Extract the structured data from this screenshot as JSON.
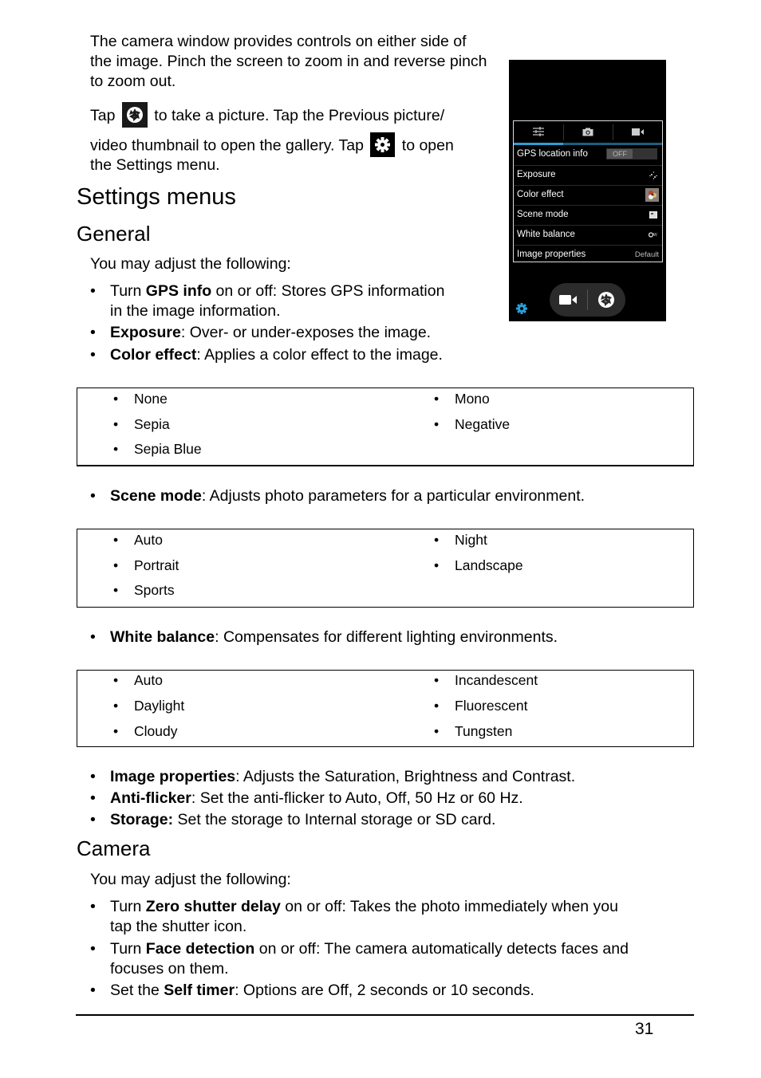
{
  "intro": {
    "paragraph": "The camera window provides controls on either side of the image. Pinch the screen to zoom in and reverse pinch to zoom out.",
    "tap_line1_prefix": "Tap",
    "tap_line1_suffix": "to take a picture. Tap the Previous picture/",
    "tap_line2_prefix": "video thumbnail to open the gallery. Tap",
    "tap_line2_suffix": "to open",
    "tap_line3": "the Settings menu.",
    "shutter_icon": "shutter-icon",
    "settings_icon": "gear-icon"
  },
  "phone": {
    "tabs": [
      {
        "icon": "sliders-icon",
        "active": true
      },
      {
        "icon": "camera-icon",
        "active": false
      },
      {
        "icon": "video-camera-icon",
        "active": false
      }
    ],
    "rows": [
      {
        "label": "GPS location info",
        "value": "OFF",
        "kind": "toggle"
      },
      {
        "label": "Exposure",
        "value": "",
        "kind": "exposure-icon"
      },
      {
        "label": "Color effect",
        "value": "",
        "kind": "color-effect-icon"
      },
      {
        "label": "Scene mode",
        "value": "",
        "kind": "scene-mode-icon"
      },
      {
        "label": "White balance",
        "value": "",
        "kind": "white-balance-icon"
      },
      {
        "label": "Image properties",
        "value": "Default",
        "kind": "text"
      }
    ],
    "accent_color": "#2a9fd8"
  },
  "settings": {
    "title": "Settings menus",
    "general": {
      "title": "General",
      "lead": "You may adjust the following:",
      "items": [
        {
          "pre": "Turn ",
          "bold": "GPS info",
          "post": " on or off: Stores GPS information",
          "cont": "in the image information."
        },
        {
          "pre": "",
          "bold": "Exposure",
          "post": ": Over- or under-exposes the image."
        },
        {
          "pre": "",
          "bold": "Color effect",
          "post": ": Applies a color effect to the image."
        }
      ],
      "color_effects": {
        "left": [
          "None",
          "Sepia",
          "Sepia Blue"
        ],
        "right": [
          "Mono",
          "Negative"
        ]
      },
      "scene_item": {
        "bold": "Scene mode",
        "post": ": Adjusts photo parameters for a particular environment."
      },
      "scene_modes": {
        "left": [
          "Auto",
          "Portrait",
          "Sports"
        ],
        "right": [
          "Night",
          "Landscape"
        ]
      },
      "wb_item": {
        "bold": "White balance",
        "post": ": Compensates for different lighting environments."
      },
      "white_balance": {
        "left": [
          "Auto",
          "Daylight",
          "Cloudy"
        ],
        "right": [
          "Incandescent",
          "Fluorescent",
          "Tungsten"
        ]
      },
      "more_items": [
        {
          "bold": "Image properties",
          "post": ": Adjusts the Saturation, Brightness and Contrast."
        },
        {
          "bold": "Anti-flicker",
          "post": ": Set the anti-flicker to Auto, Off, 50 Hz or 60 Hz."
        },
        {
          "bold": "Storage:",
          "post": " Set the storage to Internal storage or SD card."
        }
      ]
    },
    "camera": {
      "title": "Camera",
      "lead": "You may adjust the following:",
      "items": [
        {
          "pre": "Turn ",
          "bold": "Zero shutter delay",
          "post": " on or off: Takes the photo immediately when you",
          "cont": "tap the shutter icon."
        },
        {
          "pre": "Turn ",
          "bold": "Face detection",
          "post": " on or off: The camera automatically detects faces and",
          "cont": "focuses on them."
        },
        {
          "pre": "Set the ",
          "bold": "Self timer",
          "post": ": Options are Off, 2 seconds or 10 seconds."
        }
      ]
    }
  },
  "bullet": "•",
  "footer": {
    "page_number": "31"
  }
}
